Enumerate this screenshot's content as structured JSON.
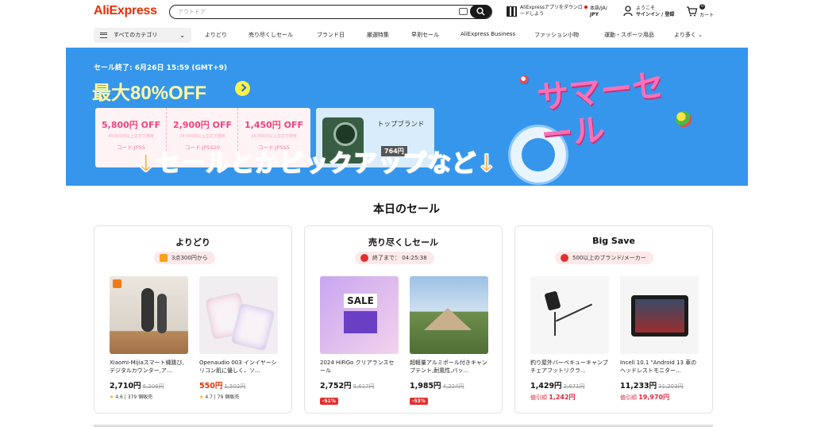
{
  "header": {
    "logo": "AliExpress",
    "search_placeholder": "アウトドア",
    "app_download": "AliExpressアプリをダウンロードしよう",
    "locale_top": "本語/JA/",
    "locale_currency": "JPY",
    "account_line1": "ようこそ",
    "account_line2": "サインイン / 登録",
    "cart_count": "0",
    "cart_label": "カート"
  },
  "nav": {
    "categories": "すべてのカテゴリ",
    "links": [
      "よりどり",
      "売り尽くしセール",
      "ブランド日",
      "厳選特集",
      "早割セール",
      "AliExpress Business",
      "ファッション小物",
      "運動・スポーツ用品",
      "より多く"
    ]
  },
  "banner": {
    "ends": "セール終了: 6月26日 15:59 (GMT+9)",
    "headline": "最大80%OFF",
    "coupons": [
      {
        "amount": "5,800円 OFF",
        "condition": "40,000円以上注文で適用",
        "code": "コード:JPSS"
      },
      {
        "amount": "2,900円 OFF",
        "condition": "20,000円以上注文で適用",
        "code": "コード:JPSS20"
      },
      {
        "amount": "1,450円 OFF",
        "condition": "10,000円以上注文で適用",
        "code": "コード:JPSS5"
      }
    ],
    "top_brand": "トップブランド",
    "top_brand_price": "764円",
    "summer_text": "サマーセール",
    "overlay_caption": "↓セールとかピックアップなど↓"
  },
  "today": {
    "title": "本日のセール",
    "cards": [
      {
        "title": "よりどり",
        "pill": "3点300円から",
        "products": [
          {
            "name": "Xiaomi-Mijiaスマート縄跳び,デジタルカウンター,ア...",
            "price": "2,710円",
            "old": "6,206円",
            "rating": "4.6",
            "sold": "379 個販売"
          },
          {
            "name": "Openaudio 003 インイヤーシリコン肌に優しく、ソ...",
            "price": "550円",
            "old": "1,502円",
            "rating": "4.7",
            "sold": "79 個販売"
          }
        ]
      },
      {
        "title": "売り尽くしセール",
        "pill": "終了まで： 04:25:38",
        "products": [
          {
            "name": "2024 HiFiGo クリアランスセール",
            "price": "2,752円",
            "old": "5,617円",
            "discount": "-51%"
          },
          {
            "name": "超軽量アルミポール付きキャンプテント,耐風性,バッ...",
            "price": "1,985円",
            "old": "4,224円",
            "discount": "-53%"
          }
        ]
      },
      {
        "title": "Big Save",
        "pill": "500以上のブランド/メーカー",
        "products": [
          {
            "name": "釣り屋外バーベキューキャンプチェアフットリクラ...",
            "price": "1,429円",
            "old": "2,671円",
            "cheap_label": "値引順",
            "cheap_price": "1,242円"
          },
          {
            "name": "Incell 10.1 \"Android 13 車のヘッドレストモニター...",
            "price": "11,233円",
            "old": "31,203円",
            "cheap_label": "値引順",
            "cheap_price": "19,970円"
          }
        ]
      }
    ]
  },
  "colors": {
    "brand": "#e62e04",
    "banner_bg": "#3596ec",
    "coupon_pink": "#f0447a",
    "overlay_orange": "#ffb24a"
  }
}
